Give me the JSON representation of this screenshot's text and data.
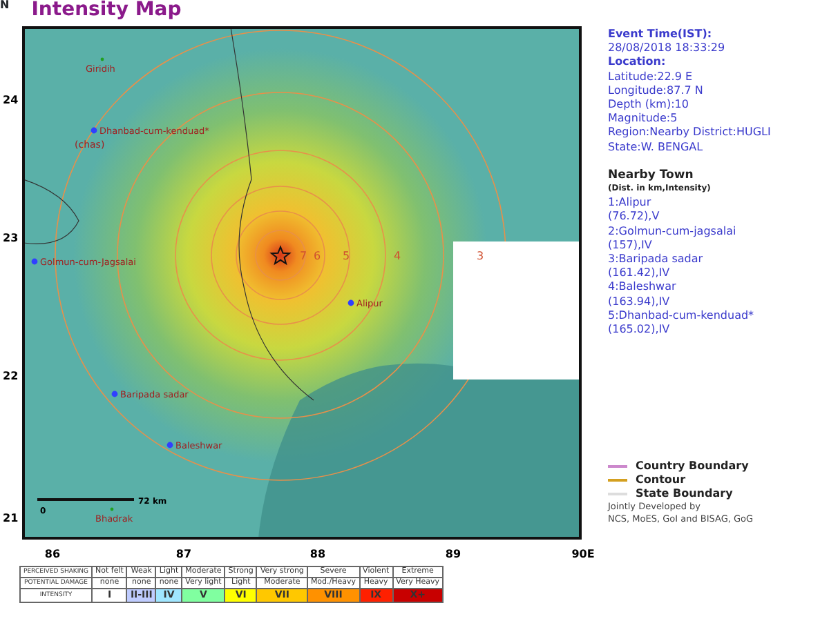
{
  "compass": "N",
  "title": "Intensity Map",
  "map": {
    "lat_ticks": [
      "24",
      "23",
      "22",
      "21"
    ],
    "lon_ticks": [
      "86",
      "87",
      "88",
      "89",
      "90E"
    ],
    "contour_labels": [
      "7",
      "6",
      "5",
      "4",
      "3"
    ],
    "towns": [
      {
        "name": "Giridih",
        "kind": "place"
      },
      {
        "name": "Dhanbad-cum-kenduad*",
        "kind": "nearby",
        "sublabel": "(chas)"
      },
      {
        "name": "Golmun-cum-Jagsalai",
        "kind": "nearby"
      },
      {
        "name": "Alipur",
        "kind": "nearby"
      },
      {
        "name": "Baripada sadar",
        "kind": "nearby"
      },
      {
        "name": "Baleshwar",
        "kind": "nearby"
      },
      {
        "name": "Bhadrak",
        "kind": "place"
      }
    ],
    "scale": {
      "start": "0",
      "end": "72 km"
    }
  },
  "event": {
    "time_label": "Event Time(IST):",
    "time": "28/08/2018 18:33:29",
    "location_label": "Location:",
    "fields": [
      "Latitude:22.9 E",
      "Longitude:87.7 N",
      "Depth (km):10",
      "Magnitude:5",
      "Region:Nearby District:HUGLI",
      "State:W. BENGAL"
    ]
  },
  "nearby": {
    "heading": "Nearby Town",
    "subheading": "(Dist. in km,Intensity)",
    "lines": [
      "1:Alipur",
      "(76.72),V",
      "2:Golmun-cum-jagsalai",
      "(157),IV",
      "3:Baripada sadar",
      "(161.42),IV",
      "4:Baleshwar",
      "(163.94),IV",
      "5:Dhanbad-cum-kenduad*",
      "(165.02),IV"
    ]
  },
  "legend": [
    {
      "label": "Country Boundary",
      "color": "#cc88cc"
    },
    {
      "label": "Contour",
      "color": "#d4a020"
    },
    {
      "label": "State Boundary",
      "color": "#dddddd"
    }
  ],
  "credit": [
    "Jointly Developed by",
    "NCS, MoES, GoI and BISAG, GoG"
  ],
  "scale_table": {
    "headers": [
      "PERCEIVED SHAKING",
      "POTENTIAL DAMAGE",
      "INTENSITY"
    ],
    "shaking": [
      "Not felt",
      "Weak",
      "Light",
      "Moderate",
      "Strong",
      "Very strong",
      "Severe",
      "Violent",
      "Extreme"
    ],
    "damage": [
      "none",
      "none",
      "none",
      "Very light",
      "Light",
      "Moderate",
      "Mod./Heavy",
      "Heavy",
      "Very Heavy"
    ],
    "intensity": [
      {
        "label": "I",
        "color": "#ffffff"
      },
      {
        "label": "II-III",
        "color": "#bfccff"
      },
      {
        "label": "IV",
        "color": "#a0e6ff"
      },
      {
        "label": "V",
        "color": "#80ffa0"
      },
      {
        "label": "VI",
        "color": "#ffff00"
      },
      {
        "label": "VII",
        "color": "#ffc800"
      },
      {
        "label": "VIII",
        "color": "#ff9100"
      },
      {
        "label": "IX",
        "color": "#ff2000"
      },
      {
        "label": "X+",
        "color": "#c80000"
      }
    ]
  }
}
